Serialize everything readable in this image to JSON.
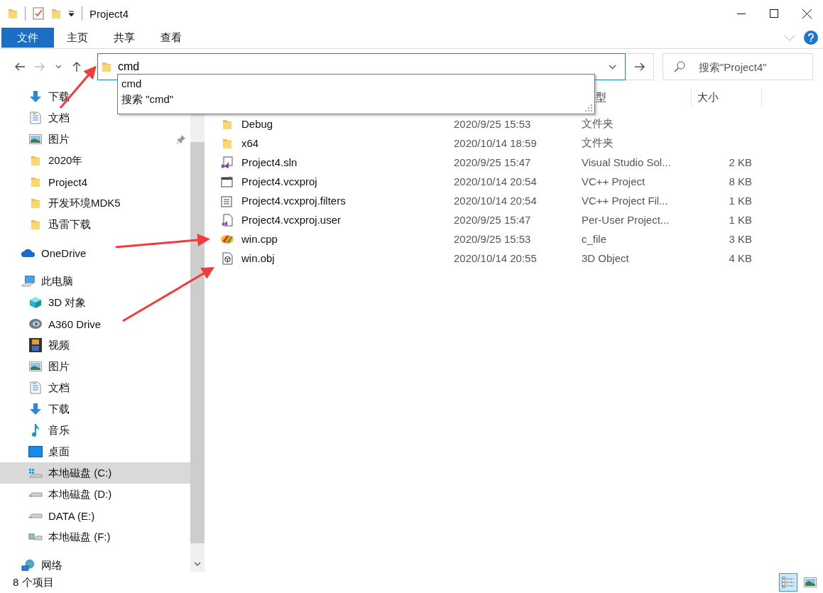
{
  "title_bar": {
    "title": "Project4"
  },
  "ribbon": {
    "tabs": [
      {
        "label": "文件",
        "kind": "file",
        "selected": false
      },
      {
        "label": "主页",
        "kind": "tab",
        "selected": false
      },
      {
        "label": "共享",
        "kind": "tab",
        "selected": false
      },
      {
        "label": "查看",
        "kind": "tab",
        "selected": false
      }
    ]
  },
  "address_bar": {
    "value": "cmd"
  },
  "search": {
    "placeholder": "搜索\"Project4\""
  },
  "autocomplete": [
    "cmd",
    "搜索 \"cmd\""
  ],
  "sidebar": {
    "quick_access": [
      {
        "label": "下载",
        "kind": "download",
        "pinned": false
      },
      {
        "label": "文档",
        "kind": "document",
        "pinned": false
      },
      {
        "label": "图片",
        "kind": "pictures",
        "pinned": true
      },
      {
        "label": "2020年",
        "kind": "folder",
        "pinned": false
      },
      {
        "label": "Project4",
        "kind": "folder",
        "pinned": false
      },
      {
        "label": "开发环境MDK5",
        "kind": "folder",
        "pinned": false
      },
      {
        "label": "迅雷下载",
        "kind": "folder",
        "pinned": false
      }
    ],
    "items": [
      {
        "label": "OneDrive",
        "kind": "cloud",
        "selected": false
      },
      {
        "label": "此电脑",
        "kind": "computer",
        "selected": false,
        "children": [
          {
            "label": "3D 对象",
            "kind": "cube3d",
            "selected": false
          },
          {
            "label": "A360 Drive",
            "kind": "a360",
            "selected": false
          },
          {
            "label": "视频",
            "kind": "video",
            "selected": false
          },
          {
            "label": "图片",
            "kind": "pictures",
            "selected": false
          },
          {
            "label": "文档",
            "kind": "document",
            "selected": false
          },
          {
            "label": "下载",
            "kind": "download",
            "selected": false
          },
          {
            "label": "音乐",
            "kind": "music",
            "selected": false
          },
          {
            "label": "桌面",
            "kind": "desktop",
            "selected": false
          },
          {
            "label": "本地磁盘 (C:)",
            "kind": "drive-windows",
            "selected": true
          },
          {
            "label": "本地磁盘 (D:)",
            "kind": "drive",
            "selected": false
          },
          {
            "label": "DATA (E:)",
            "kind": "drive",
            "selected": false
          },
          {
            "label": "本地磁盘 (F:)",
            "kind": "drive-picture",
            "selected": false
          }
        ]
      },
      {
        "label": "网络",
        "kind": "network",
        "selected": false
      }
    ]
  },
  "file_list": {
    "columns": [
      "型",
      "大小"
    ],
    "rows": [
      {
        "name": "Debug",
        "kind": "folder",
        "date": "2020/9/25 15:53",
        "type": "文件夹",
        "size": ""
      },
      {
        "name": "x64",
        "kind": "folder",
        "date": "2020/10/14 18:59",
        "type": "文件夹",
        "size": ""
      },
      {
        "name": "Project4.sln",
        "kind": "sln",
        "date": "2020/9/25 15:47",
        "type": "Visual Studio Sol...",
        "size": "2 KB"
      },
      {
        "name": "Project4.vcxproj",
        "kind": "vcxproj",
        "date": "2020/10/14 20:54",
        "type": "VC++ Project",
        "size": "8 KB"
      },
      {
        "name": "Project4.vcxproj.filters",
        "kind": "filters",
        "date": "2020/10/14 20:54",
        "type": "VC++ Project Fil...",
        "size": "1 KB"
      },
      {
        "name": "Project4.vcxproj.user",
        "kind": "user",
        "date": "2020/9/25 15:47",
        "type": "Per-User Project...",
        "size": "1 KB"
      },
      {
        "name": "win.cpp",
        "kind": "cpp",
        "date": "2020/9/25 15:53",
        "type": "c_file",
        "size": "3 KB"
      },
      {
        "name": "win.obj",
        "kind": "obj",
        "date": "2020/10/14 20:55",
        "type": "3D Object",
        "size": "4 KB"
      }
    ]
  },
  "status_bar": {
    "item_count": "8 个项目",
    "views": [
      {
        "kind": "details",
        "selected": true
      },
      {
        "kind": "large-icons",
        "selected": false
      }
    ]
  }
}
